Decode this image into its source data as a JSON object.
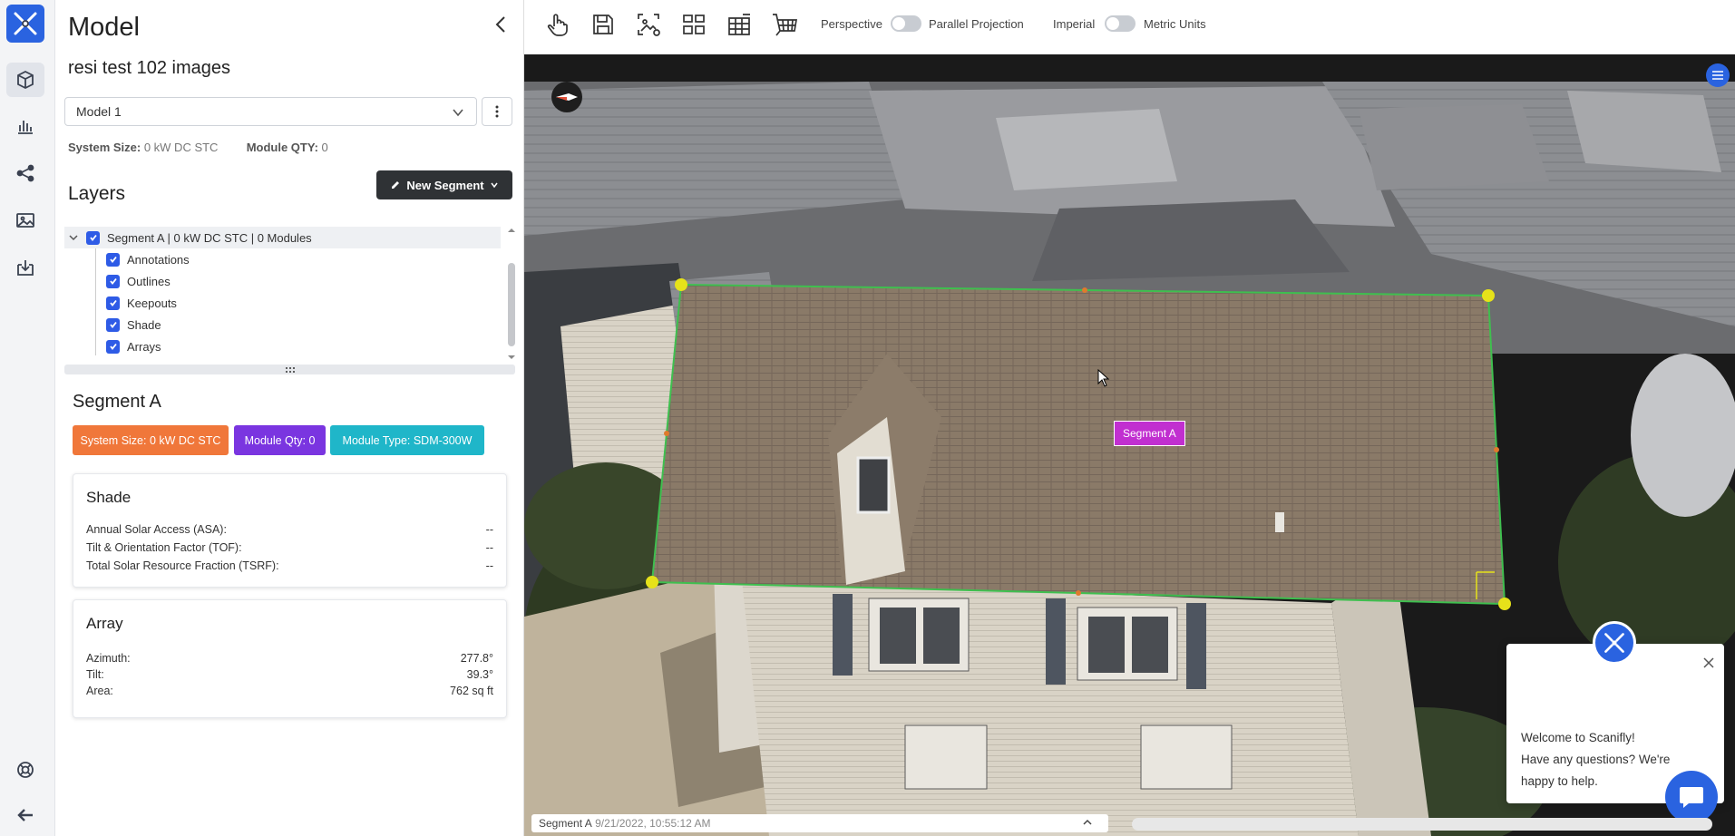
{
  "panel": {
    "title": "Model",
    "project_name": "resi test 102 images",
    "model_select": "Model 1",
    "system_size_label": "System Size:",
    "system_size_value": "0 kW DC STC",
    "module_qty_label": "Module QTY:",
    "module_qty_value": "0",
    "layers_heading": "Layers",
    "new_segment_label": "New Segment"
  },
  "layers": {
    "parent": "Segment A | 0 kW DC STC | 0 Modules",
    "children": [
      "Annotations",
      "Outlines",
      "Keepouts",
      "Shade",
      "Arrays"
    ]
  },
  "segment": {
    "heading": "Segment A",
    "badges": [
      {
        "label": "System Size: 0 kW DC STC",
        "color": "#f0773a"
      },
      {
        "label": "Module Qty: 0",
        "color": "#7a35e0"
      },
      {
        "label": "Module Type: SDM-300W",
        "color": "#1fb6c9"
      }
    ]
  },
  "shade": {
    "heading": "Shade",
    "rows": [
      {
        "k": "Annual Solar Access (ASA):",
        "v": "--"
      },
      {
        "k": "Tilt & Orientation Factor (TOF):",
        "v": "--"
      },
      {
        "k": "Total Solar Resource Fraction (TSRF):",
        "v": "--"
      }
    ]
  },
  "array": {
    "heading": "Array",
    "rows": [
      {
        "k": "Azimuth:",
        "v": "277.8°"
      },
      {
        "k": "Tilt:",
        "v": "39.3°"
      },
      {
        "k": "Area:",
        "v": "762 sq ft"
      }
    ]
  },
  "toolbar": {
    "perspective": "Perspective",
    "parallel": "Parallel Projection",
    "imperial": "Imperial",
    "metric": "Metric Units"
  },
  "viewport": {
    "segment_label": "Segment A",
    "status_segment": "Segment A",
    "status_time": "9/21/2022, 10:55:12 AM"
  },
  "chat": {
    "line1": "Welcome to Scanifly!",
    "line2": "Have any questions? We're happy to help."
  },
  "colors": {
    "brand": "#2a63e0",
    "checkbox": "#2e5be6",
    "segment_label": "#c12fd0",
    "roof_outline": "#3fbf4f",
    "vertex": "#e6e21a"
  }
}
